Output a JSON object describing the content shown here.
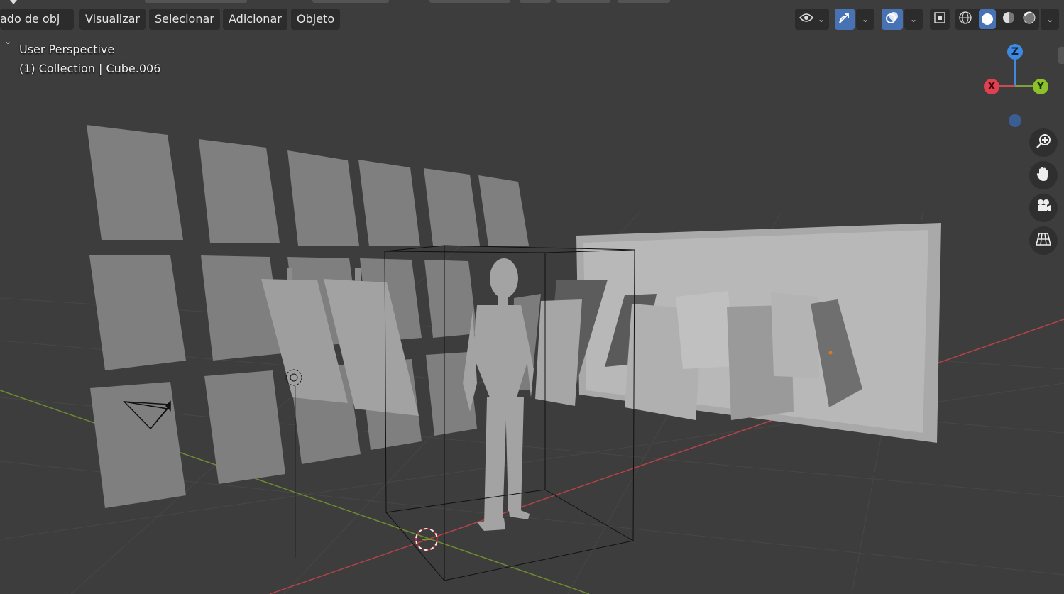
{
  "header_menu": {
    "mode_label": "ado de obj",
    "view": "Visualizar",
    "select": "Selecionar",
    "add": "Adicionar",
    "object": "Objeto"
  },
  "overlay": {
    "perspective": "User Perspective",
    "collection": "(1) Collection | Cube.006"
  },
  "axes": {
    "z": "Z",
    "x": "X",
    "y": "Y"
  },
  "colors": {
    "background": "#3d3d3d",
    "grid": "#4a4a4a",
    "x_axis": "#c84a52",
    "y_axis": "#7ea03a",
    "z_axis": "#3d8ae0",
    "accent": "#4772b3",
    "objects": "#8a8a8a"
  },
  "icons": {
    "visibility": "eye-icon",
    "gizmo": "transform-gizmo-icon",
    "overlays": "overlays-icon",
    "xray": "xray-icon",
    "wireframe": "wireframe-shading-icon",
    "solid": "solid-shading-icon",
    "material": "material-shading-icon",
    "rendered": "rendered-shading-icon",
    "zoom": "zoom-icon",
    "pan": "hand-icon",
    "camera": "camera-icon",
    "grid": "grid-icon"
  }
}
